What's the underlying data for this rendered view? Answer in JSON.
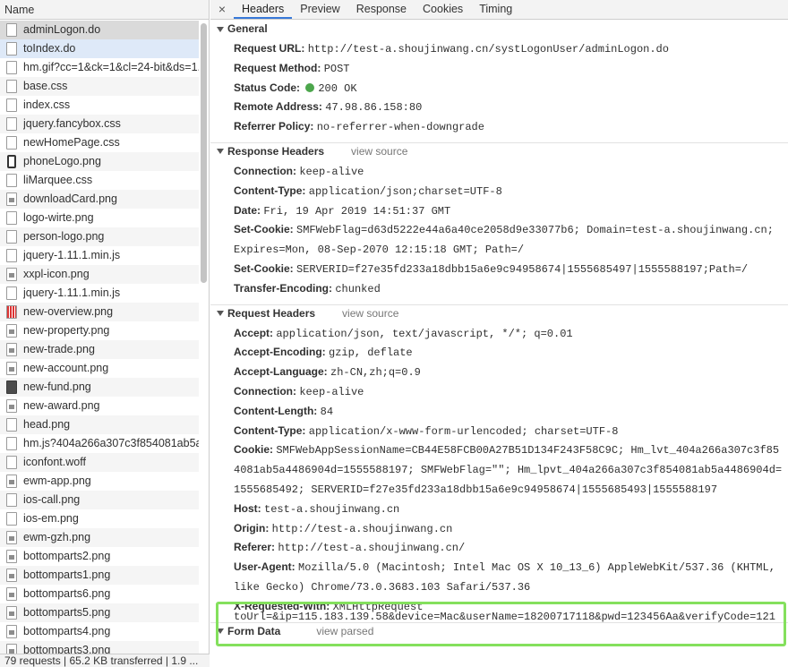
{
  "left": {
    "header": "Name",
    "files": [
      {
        "name": "adminLogon.do",
        "icon": "doc"
      },
      {
        "name": "toIndex.do",
        "icon": "doc"
      },
      {
        "name": "hm.gif?cc=1&ck=1&cl=24-bit&ds=1...",
        "icon": "doc"
      },
      {
        "name": "base.css",
        "icon": "doc"
      },
      {
        "name": "index.css",
        "icon": "doc"
      },
      {
        "name": "jquery.fancybox.css",
        "icon": "doc"
      },
      {
        "name": "newHomePage.css",
        "icon": "doc"
      },
      {
        "name": "phoneLogo.png",
        "icon": "phone"
      },
      {
        "name": "liMarquee.css",
        "icon": "doc"
      },
      {
        "name": "downloadCard.png",
        "icon": "img"
      },
      {
        "name": "logo-wirte.png",
        "icon": "doc"
      },
      {
        "name": "person-logo.png",
        "icon": "doc"
      },
      {
        "name": "jquery-1.11.1.min.js",
        "icon": "doc"
      },
      {
        "name": "xxpl-icon.png",
        "icon": "img"
      },
      {
        "name": "jquery-1.11.1.min.js",
        "icon": "doc"
      },
      {
        "name": "new-overview.png",
        "icon": "grid"
      },
      {
        "name": "new-property.png",
        "icon": "img"
      },
      {
        "name": "new-trade.png",
        "icon": "img"
      },
      {
        "name": "new-account.png",
        "icon": "img"
      },
      {
        "name": "new-fund.png",
        "icon": "dark"
      },
      {
        "name": "new-award.png",
        "icon": "img"
      },
      {
        "name": "head.png",
        "icon": "doc"
      },
      {
        "name": "hm.js?404a266a307c3f854081ab5a...",
        "icon": "doc"
      },
      {
        "name": "iconfont.woff",
        "icon": "doc"
      },
      {
        "name": "ewm-app.png",
        "icon": "img"
      },
      {
        "name": "ios-call.png",
        "icon": "doc"
      },
      {
        "name": "ios-em.png",
        "icon": "doc"
      },
      {
        "name": "ewm-gzh.png",
        "icon": "img"
      },
      {
        "name": "bottomparts2.png",
        "icon": "img"
      },
      {
        "name": "bottomparts1.png",
        "icon": "img"
      },
      {
        "name": "bottomparts6.png",
        "icon": "img"
      },
      {
        "name": "bottomparts5.png",
        "icon": "img"
      },
      {
        "name": "bottomparts4.png",
        "icon": "img"
      },
      {
        "name": "bottomparts3.png",
        "icon": "img"
      }
    ],
    "status": "79 requests | 65.2 KB transferred | 1.9 ..."
  },
  "tabs": {
    "close": "×",
    "items": [
      "Headers",
      "Preview",
      "Response",
      "Cookies",
      "Timing"
    ]
  },
  "general": {
    "title": "General",
    "rows": [
      {
        "name": "Request URL:",
        "value": "http://test-a.shoujinwang.cn/systLogonUser/adminLogon.do"
      },
      {
        "name": "Request Method:",
        "value": "POST"
      },
      {
        "name": "Status Code:",
        "value": "200 OK"
      },
      {
        "name": "Remote Address:",
        "value": "47.98.86.158:80"
      },
      {
        "name": "Referrer Policy:",
        "value": "no-referrer-when-downgrade"
      }
    ]
  },
  "response_headers": {
    "title": "Response Headers",
    "link": "view source",
    "rows": [
      {
        "name": "Connection:",
        "value": "keep-alive"
      },
      {
        "name": "Content-Type:",
        "value": "application/json;charset=UTF-8"
      },
      {
        "name": "Date:",
        "value": "Fri, 19 Apr 2019 14:51:37 GMT"
      },
      {
        "name": "Set-Cookie:",
        "value": "SMFWebFlag=d63d5222e44a6a40ce2058d9e33077b6; Domain=test-a.shoujinwang.cn; Expires=Mon, 08-Sep-2070 12:15:18 GMT; Path=/"
      },
      {
        "name": "Set-Cookie:",
        "value": "SERVERID=f27e35fd233a18dbb15a6e9c94958674|1555685497|1555588197;Path=/"
      },
      {
        "name": "Transfer-Encoding:",
        "value": "chunked"
      }
    ]
  },
  "request_headers": {
    "title": "Request Headers",
    "link": "view source",
    "rows": [
      {
        "name": "Accept:",
        "value": "application/json, text/javascript, */*; q=0.01"
      },
      {
        "name": "Accept-Encoding:",
        "value": "gzip, deflate"
      },
      {
        "name": "Accept-Language:",
        "value": "zh-CN,zh;q=0.9"
      },
      {
        "name": "Connection:",
        "value": "keep-alive"
      },
      {
        "name": "Content-Length:",
        "value": "84"
      },
      {
        "name": "Content-Type:",
        "value": "application/x-www-form-urlencoded; charset=UTF-8"
      },
      {
        "name": "Cookie:",
        "value": "SMFWebAppSessionName=CB44E58FCB00A27B51D134F243F58C9C; Hm_lvt_404a266a307c3f854081ab5a4486904d=1555588197; SMFWebFlag=\"\"; Hm_lpvt_404a266a307c3f854081ab5a4486904d=1555685492; SERVERID=f27e35fd233a18dbb15a6e9c94958674|1555685493|1555588197"
      },
      {
        "name": "Host:",
        "value": "test-a.shoujinwang.cn"
      },
      {
        "name": "Origin:",
        "value": "http://test-a.shoujinwang.cn"
      },
      {
        "name": "Referer:",
        "value": "http://test-a.shoujinwang.cn/"
      },
      {
        "name": "User-Agent:",
        "value": "Mozilla/5.0 (Macintosh; Intel Mac OS X 10_13_6) AppleWebKit/537.36 (KHTML, like Gecko) Chrome/73.0.3683.103 Safari/537.36"
      },
      {
        "name": "X-Requested-With:",
        "value": "XMLHttpRequest"
      }
    ]
  },
  "form_data": {
    "title": "Form Data",
    "link": "view parsed",
    "value": "toUrl=&ip=115.183.139.58&device=Mac&userName=18200717118&pwd=123456Aa&verifyCode=121"
  },
  "colors": {
    "highlight": "#84e05d",
    "status_ok": "#4ca64c",
    "active_tab": "#3879d9"
  }
}
